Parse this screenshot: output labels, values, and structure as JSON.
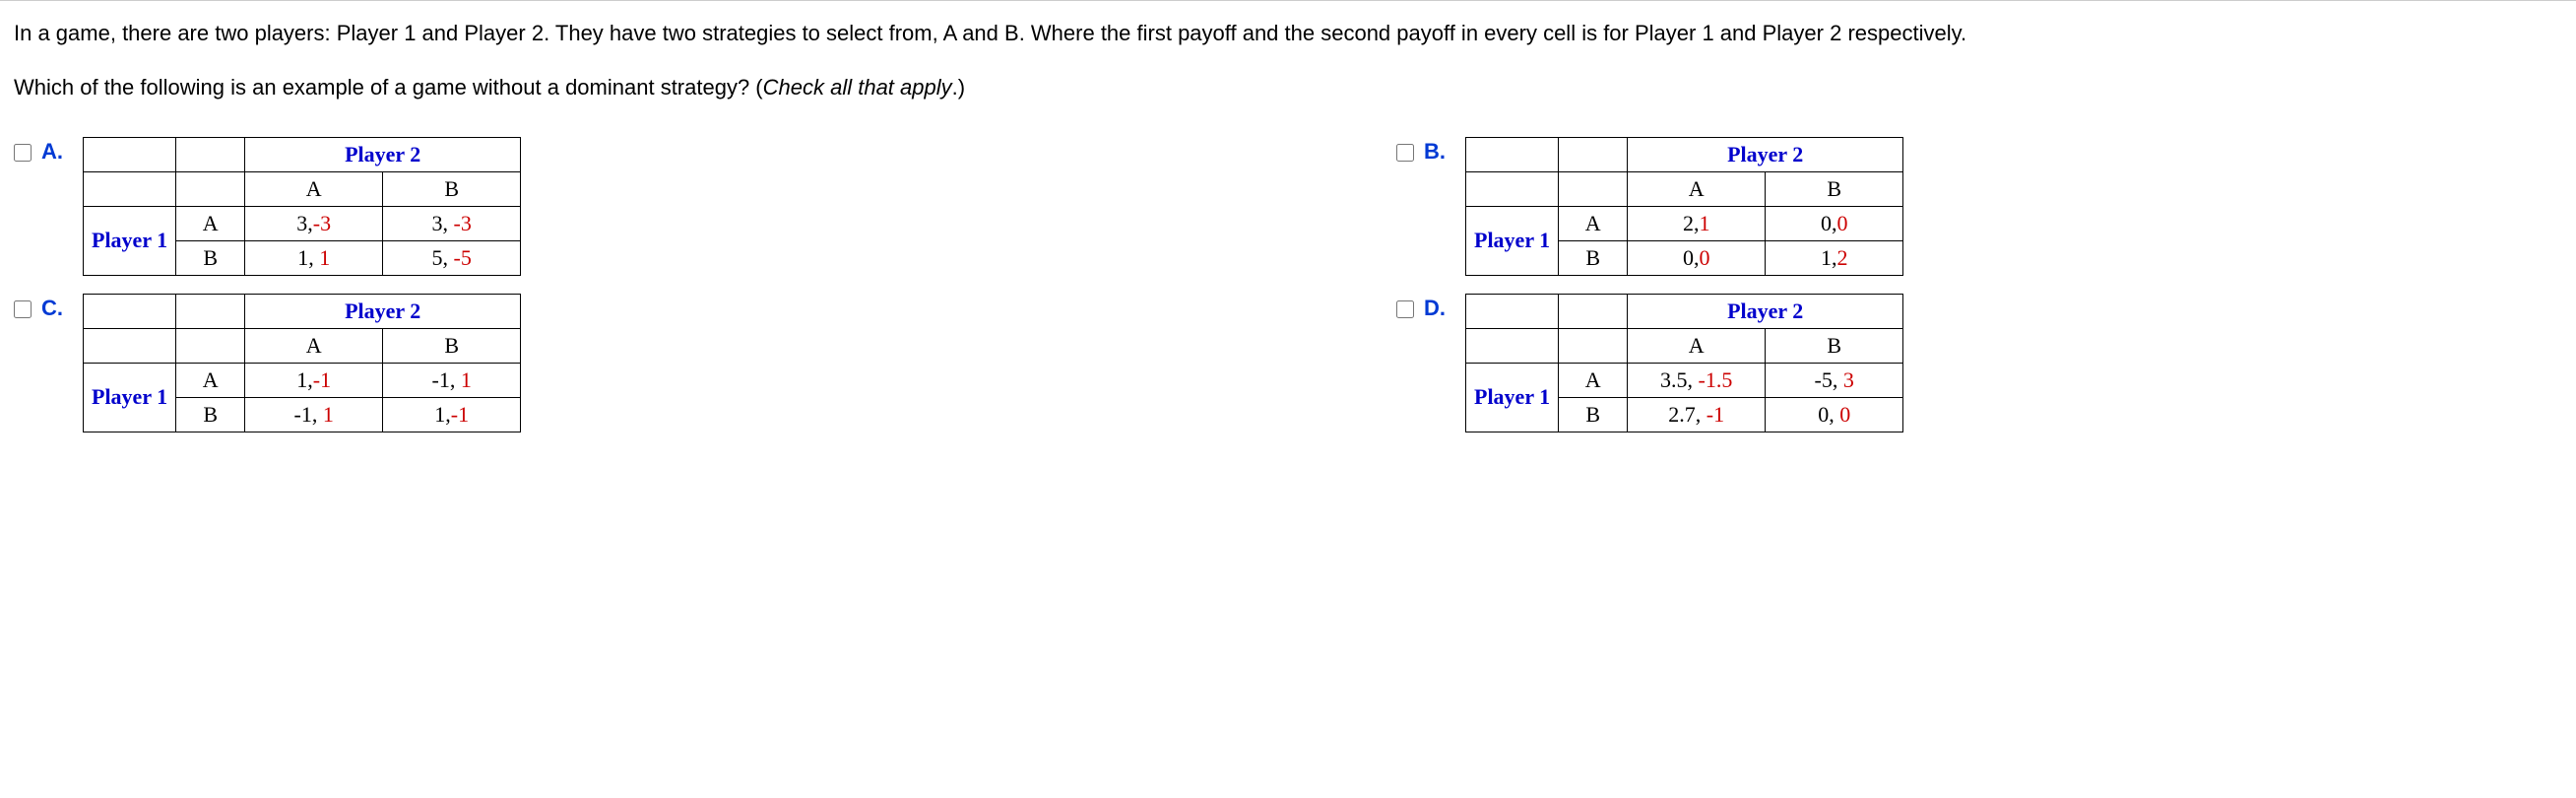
{
  "question": {
    "line1": "In a game, there are two players: Player 1 and Player 2. They have two strategies to select from, A and B. Where the first payoff and the second payoff in every cell is for Player 1 and Player 2 respectively.",
    "line2_prefix": "Which of the following is an example of a game without a dominant strategy? (",
    "line2_em": "Check all that apply",
    "line2_suffix": ".)"
  },
  "labels": {
    "player1": "Player 1",
    "player2": "Player 2",
    "A": "A",
    "B": "B"
  },
  "options": {
    "A": {
      "letter": "A.",
      "cells": {
        "AA": {
          "p1": "3",
          "sep": ",",
          "p2": "-3"
        },
        "AB": {
          "p1": "3",
          "sep": ", ",
          "p2": "-3"
        },
        "BA": {
          "p1": "1",
          "sep": ", ",
          "p2": "1"
        },
        "BB": {
          "p1": "5",
          "sep": ", ",
          "p2": "-5"
        }
      }
    },
    "B": {
      "letter": "B.",
      "cells": {
        "AA": {
          "p1": "2",
          "sep": ",",
          "p2": "1"
        },
        "AB": {
          "p1": "0",
          "sep": ",",
          "p2": "0"
        },
        "BA": {
          "p1": "0",
          "sep": ",",
          "p2": "0"
        },
        "BB": {
          "p1": "1",
          "sep": ",",
          "p2": "2"
        }
      }
    },
    "C": {
      "letter": "C.",
      "cells": {
        "AA": {
          "p1": "1",
          "sep": ",",
          "p2": "-1"
        },
        "AB": {
          "p1": "-1",
          "sep": ", ",
          "p2": "1"
        },
        "BA": {
          "p1": "-1",
          "sep": ", ",
          "p2": "1"
        },
        "BB": {
          "p1": "1",
          "sep": ",",
          "p2": "-1"
        }
      }
    },
    "D": {
      "letter": "D.",
      "cells": {
        "AA": {
          "p1": "3.5",
          "sep": ", ",
          "p2": "-1.5"
        },
        "AB": {
          "p1": "-5",
          "sep": ", ",
          "p2": "3"
        },
        "BA": {
          "p1": "2.7",
          "sep": ",  ",
          "p2": "-1"
        },
        "BB": {
          "p1": "0",
          "sep": ", ",
          "p2": "0"
        }
      }
    }
  }
}
